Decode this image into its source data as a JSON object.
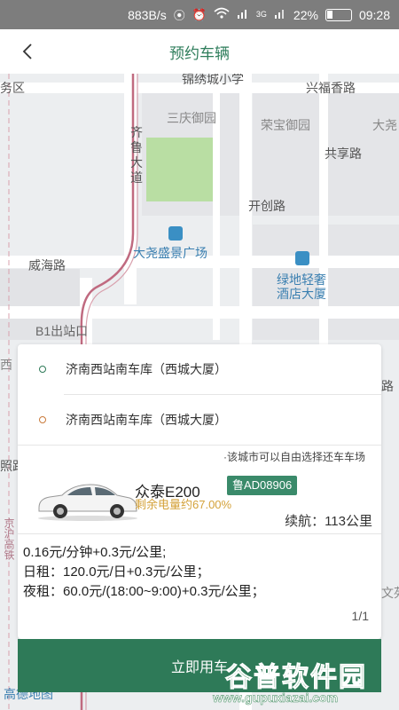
{
  "status_bar": {
    "net_speed": "883B/s",
    "signal_label": "3G",
    "battery_percent": "22%",
    "time": "09:28"
  },
  "nav": {
    "title": "预约车辆"
  },
  "map": {
    "labels": {
      "district": "务区",
      "jinxiu": "锦绣城小学",
      "xingfu": "兴福香路",
      "sanqing": "三庆御园",
      "rongbao": "荣宝御园",
      "da_right": "大尧",
      "qilu": "齐\n鲁\n大\n道",
      "gongxiang": "共享路",
      "kaichuang": "开创路",
      "dayao": "大尧盛景广场",
      "weihai": "威海路",
      "lvdi1": "绿地轻奢",
      "lvdi2": "酒店大厦",
      "b1": "B1出站口",
      "xi": "西",
      "lu": "路",
      "zhao": "照路",
      "jinghu": "京沪高铁",
      "wenyuan": "文苑"
    },
    "logo": "高德地图"
  },
  "panel": {
    "pickup": "济南西站南车库（西城大厦）",
    "return": "济南西站南车库（西城大厦）",
    "note": "·该城市可以自由选择还车车场",
    "car_name": "众泰E200",
    "plate": "鲁AD08906",
    "battery_text": "剩余电量约67.00%",
    "range": "续航：113公里",
    "price_lines": [
      "0.16元/分钟+0.3元/公里;",
      "日租：120.0元/日+0.3元/公里；",
      "夜租：60.0元/(18:00~9:00)+0.3元/公里；"
    ],
    "pager": "1/1"
  },
  "action": {
    "book_label": "立即用车"
  },
  "watermark": {
    "main": "谷普软件园",
    "url": "www.gupuxiazai.com"
  },
  "colors": {
    "brand_green": "#2e7a58",
    "battery_orange": "#d4a23a",
    "plate_green": "#3a8a6a"
  }
}
